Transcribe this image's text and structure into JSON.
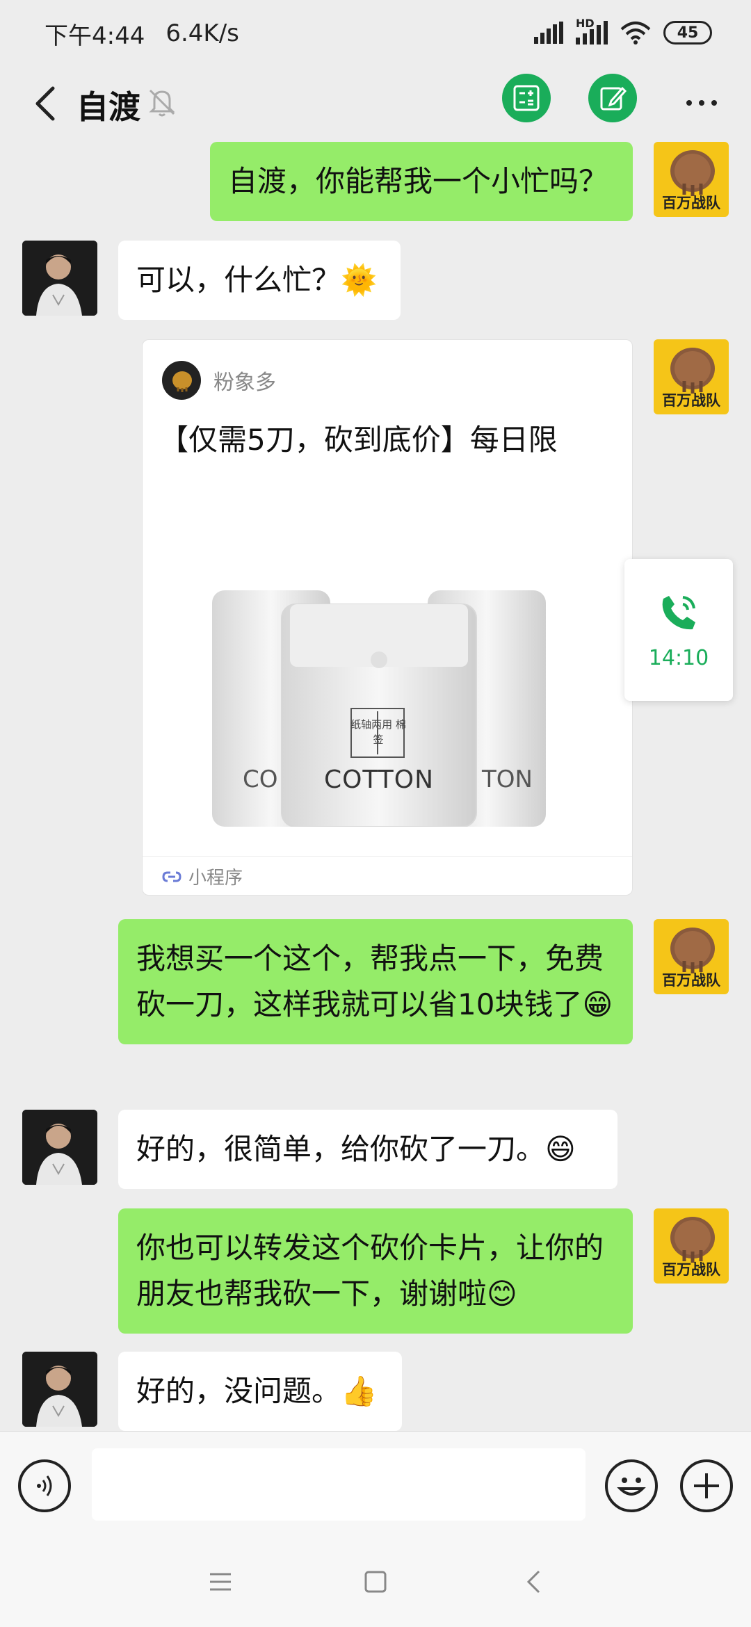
{
  "status_bar": {
    "time": "下午4:44",
    "speed": "6.4K/s",
    "network": "HD",
    "battery": "45"
  },
  "chat": {
    "title": "自渡"
  },
  "messages": [
    {
      "side": "right",
      "text": "自渡，你能帮我一个小忙吗？"
    },
    {
      "side": "left",
      "text": "可以，什么忙？🌞"
    },
    {
      "side": "right",
      "text": "我想买一个这个，帮我点一下，免费砍一刀，这样我就可以省10块钱了😁"
    },
    {
      "side": "left",
      "text": "好的，很简单，给你砍了一刀。😄"
    },
    {
      "side": "right",
      "text": "你也可以转发这个砍价卡片，让你的朋友也帮我砍一下，谢谢啦😊"
    },
    {
      "side": "left",
      "text": "好的，没问题。👍"
    }
  ],
  "avatar_label": "百万战队",
  "mini_card": {
    "source": "粉象多",
    "title": "【仅需5刀，砍到底价】每日限",
    "footer": "小程序",
    "product_label": "COTTON",
    "product_box_text": "纸轴两用 棉签",
    "product_side_left": "CO",
    "product_side_right": "TON"
  },
  "call_float": {
    "time": "14:10"
  },
  "input_bar": {
    "placeholder": ""
  },
  "colors": {
    "accent_green": "#1aad5a",
    "bubble_green": "#95ec69",
    "background": "#ededed"
  }
}
